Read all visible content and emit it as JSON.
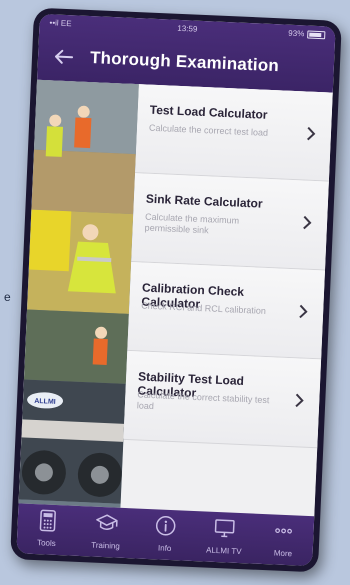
{
  "edge_text": "e",
  "status": {
    "carrier": "••il EE",
    "time": "13:59",
    "battery": "93%"
  },
  "header": {
    "title": "Thorough Examination"
  },
  "menu": {
    "items": [
      {
        "title": "Test Load Calculator",
        "subtitle": "Calculate the correct test load"
      },
      {
        "title": "Sink Rate Calculator",
        "subtitle": "Calculate the maximum permissible sink"
      },
      {
        "title": "Calibration Check Calculator",
        "subtitle": "Check RCI and RCL calibration"
      },
      {
        "title": "Stability Test Load Calculator",
        "subtitle": "Calculate the correct stability test load"
      }
    ]
  },
  "tabbar": {
    "tabs": [
      {
        "label": "Tools",
        "icon": "calculator-icon"
      },
      {
        "label": "Training",
        "icon": "graduation-cap-icon"
      },
      {
        "label": "Info",
        "icon": "info-icon"
      },
      {
        "label": "ALLMI TV",
        "icon": "monitor-icon"
      },
      {
        "label": "More",
        "icon": "more-dots-icon"
      }
    ]
  },
  "colors": {
    "brand_purple": "#3b2466",
    "background_blue": "#b9c7de"
  }
}
